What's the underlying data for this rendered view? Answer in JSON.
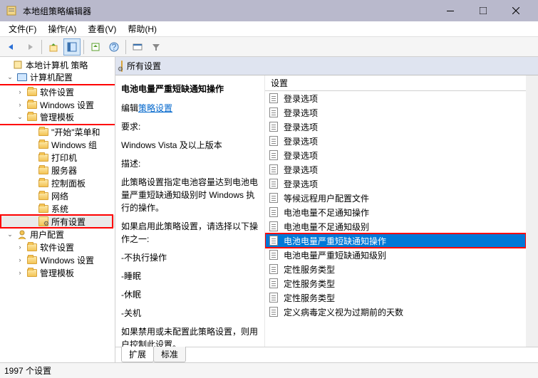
{
  "titlebar": {
    "title": "本地组策略编辑器"
  },
  "menu": {
    "file": "文件(F)",
    "action": "操作(A)",
    "view": "查看(V)",
    "help": "帮助(H)"
  },
  "tree": {
    "root": "本地计算机 策略",
    "computer": "计算机配置",
    "sw1": "软件设置",
    "win1": "Windows 设置",
    "admin": "管理模板",
    "start": "\"开始\"菜单和",
    "wincomp": "Windows 组",
    "printer": "打印机",
    "server": "服务器",
    "ctrl": "控制面板",
    "net": "网络",
    "sys": "系统",
    "all": "所有设置",
    "user": "用户配置",
    "sw2": "软件设置",
    "win2": "Windows 设置",
    "admin2": "管理模板"
  },
  "header": {
    "title": "所有设置"
  },
  "detail": {
    "title": "电池电量严重短缺通知操作",
    "edit_prefix": "编辑",
    "edit_link": "策略设置",
    "req_label": "要求:",
    "req_val": "Windows Vista 及以上版本",
    "desc_label": "描述:",
    "desc_text": "此策略设置指定电池容量达到电池电量严重短缺通知级别时 Windows 执行的操作。",
    "enable_text": "如果启用此策略设置，请选择以下操作之一:",
    "opt1": "-不执行操作",
    "opt2": "-睡眠",
    "opt3": "-休眠",
    "opt4": "-关机",
    "disable_text": "如果禁用或未配置此策略设置，则用户控制此设置。"
  },
  "list": {
    "col": "设置",
    "items": [
      "登录选项",
      "登录选项",
      "登录选项",
      "登录选项",
      "登录选项",
      "登录选项",
      "登录选项",
      "等候远程用户配置文件",
      "电池电量不足通知操作",
      "电池电量不足通知级别",
      "电池电量严重短缺通知操作",
      "电池电量严重短缺通知级别",
      "定性服务类型",
      "定性服务类型",
      "定性服务类型",
      "定义病毒定义视为过期前的天数"
    ],
    "selected_index": 10
  },
  "tabs": {
    "ext": "扩展",
    "std": "标准"
  },
  "status": {
    "text": "1997 个设置"
  }
}
